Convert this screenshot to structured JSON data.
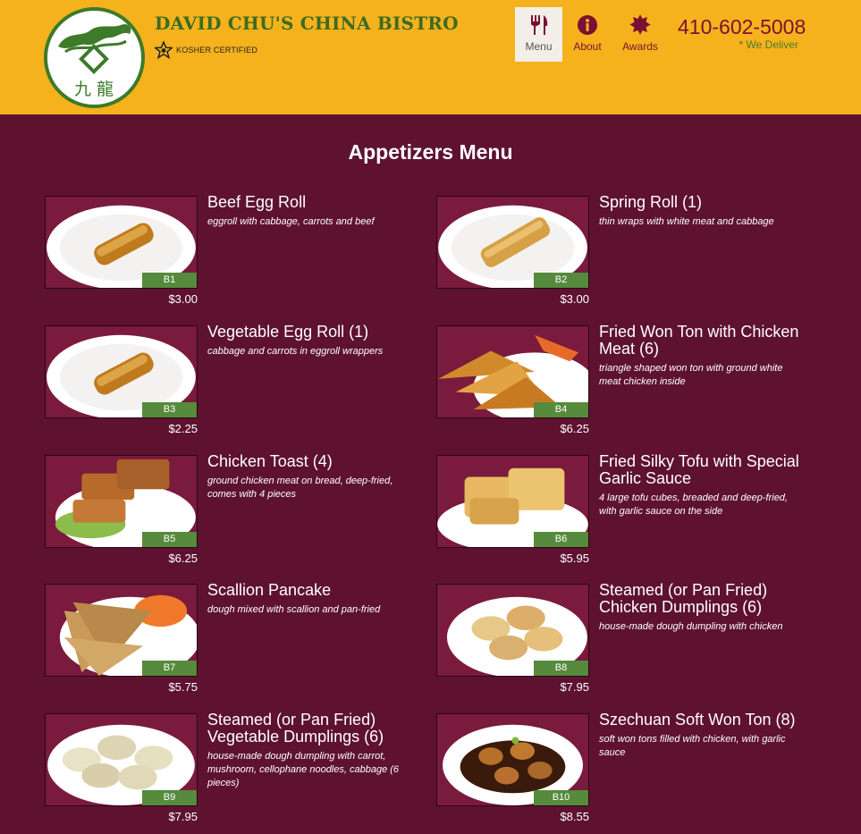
{
  "header": {
    "brand": "DAVID CHU'S CHINA BISTRO",
    "kosher_label": "KOSHER CERTIFIED",
    "logo_text": "九 龍",
    "nav": [
      {
        "label": "Menu",
        "icon": "utensils-icon"
      },
      {
        "label": "About",
        "icon": "info-icon"
      },
      {
        "label": "Awards",
        "icon": "award-icon"
      }
    ],
    "phone": "410-602-5008",
    "deliver": "* We Deliver"
  },
  "colors": {
    "header_bg": "#f5b21d",
    "page_bg": "#5e1230",
    "accent": "#7a1035",
    "green": "#568a3c"
  },
  "page_title": "Appetizers Menu",
  "items": [
    {
      "code": "B1",
      "name": "Beef Egg Roll",
      "desc": "eggroll with cabbage, carrots and beef",
      "price": "$3.00",
      "photo": "egg-roll"
    },
    {
      "code": "B2",
      "name": "Spring Roll (1)",
      "desc": "thin wraps with white meat and cabbage",
      "price": "$3.00",
      "photo": "spring-roll"
    },
    {
      "code": "B3",
      "name": "Vegetable Egg Roll (1)",
      "desc": "cabbage and carrots in eggroll wrappers",
      "price": "$2.25",
      "photo": "egg-roll"
    },
    {
      "code": "B4",
      "name": "Fried Won Ton with Chicken Meat (6)",
      "desc": "triangle shaped won ton with ground white meat chicken inside",
      "price": "$6.25",
      "photo": "won-ton"
    },
    {
      "code": "B5",
      "name": "Chicken Toast (4)",
      "desc": "ground chicken meat on bread, deep-fried, comes with 4 pieces",
      "price": "$6.25",
      "photo": "toast"
    },
    {
      "code": "B6",
      "name": "Fried Silky Tofu with Special Garlic Sauce",
      "desc": "4 large tofu cubes, breaded and deep-fried, with garlic sauce on the side",
      "price": "$5.95",
      "photo": "tofu"
    },
    {
      "code": "B7",
      "name": "Scallion Pancake",
      "desc": "dough mixed with scallion and pan-fried",
      "price": "$5.75",
      "photo": "pancake"
    },
    {
      "code": "B8",
      "name": "Steamed (or Pan Fried) Chicken Dumplings (6)",
      "desc": "house-made dough dumpling with chicken",
      "price": "$7.95",
      "photo": "dumplings"
    },
    {
      "code": "B9",
      "name": "Steamed (or Pan Fried) Vegetable Dumplings (6)",
      "desc": "house-made dough dumpling with carrot, mushroom, cellophane noodles, cabbage (6 pieces)",
      "price": "$7.95",
      "photo": "veg-dumplings"
    },
    {
      "code": "B10",
      "name": "Szechuan Soft Won Ton (8)",
      "desc": "soft won tons filled with chicken, with garlic sauce",
      "price": "$8.55",
      "photo": "soft-won-ton"
    }
  ]
}
